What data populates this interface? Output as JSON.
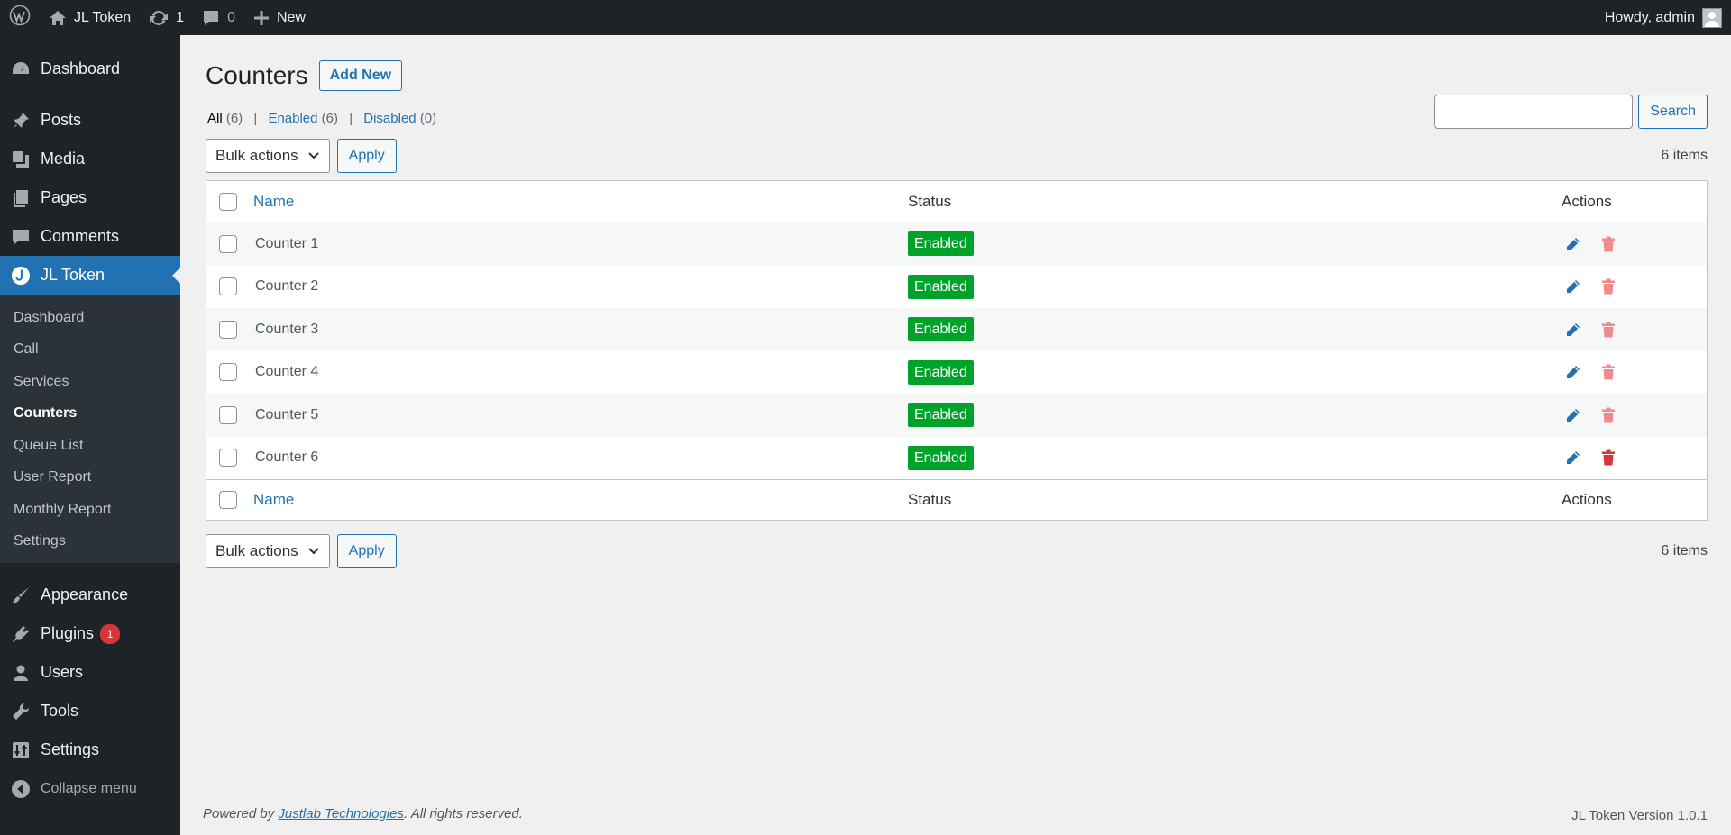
{
  "adminbar": {
    "site_name": "JL Token",
    "updates_count": "1",
    "comments_count": "0",
    "new_label": "New",
    "howdy": "Howdy, admin"
  },
  "sidebar": {
    "items_top": [
      {
        "label": "Dashboard",
        "icon": "dashboard-icon"
      },
      {
        "label": "Posts",
        "icon": "pin-icon"
      },
      {
        "label": "Media",
        "icon": "media-icon"
      },
      {
        "label": "Pages",
        "icon": "pages-icon"
      },
      {
        "label": "Comments",
        "icon": "comment-icon"
      },
      {
        "label": "JL Token",
        "icon": "jl-token-icon"
      }
    ],
    "submenu": [
      "Dashboard",
      "Call",
      "Services",
      "Counters",
      "Queue List",
      "User Report",
      "Monthly Report",
      "Settings"
    ],
    "items_bottom": [
      {
        "label": "Appearance",
        "icon": "brush-icon"
      },
      {
        "label": "Plugins",
        "icon": "plugin-icon",
        "badge": "1"
      },
      {
        "label": "Users",
        "icon": "user-icon"
      },
      {
        "label": "Tools",
        "icon": "wrench-icon"
      },
      {
        "label": "Settings",
        "icon": "settings-icon"
      }
    ],
    "collapse_label": "Collapse menu"
  },
  "page": {
    "title": "Counters",
    "add_new": "Add New",
    "filters": {
      "all": "All",
      "all_count": "(6)",
      "enabled": "Enabled",
      "enabled_count": "(6)",
      "disabled": "Disabled",
      "disabled_count": "(0)"
    },
    "search_button": "Search",
    "bulk_actions": "Bulk actions",
    "apply": "Apply",
    "items_count": "6 items"
  },
  "table": {
    "headers": {
      "name": "Name",
      "status": "Status",
      "actions": "Actions"
    },
    "rows": [
      {
        "name": "Counter 1",
        "status": "Enabled"
      },
      {
        "name": "Counter 2",
        "status": "Enabled"
      },
      {
        "name": "Counter 3",
        "status": "Enabled"
      },
      {
        "name": "Counter 4",
        "status": "Enabled"
      },
      {
        "name": "Counter 5",
        "status": "Enabled"
      },
      {
        "name": "Counter 6",
        "status": "Enabled"
      }
    ]
  },
  "footer": {
    "powered_by": "Powered by",
    "company": "Justlab Technologies",
    "rights": ". All rights reserved.",
    "version": "JL Token Version 1.0.1"
  },
  "colors": {
    "accent": "#2271b1",
    "enabled": "#00a32a",
    "delete": "#d63638",
    "delete_faded": "#f08a8c"
  }
}
